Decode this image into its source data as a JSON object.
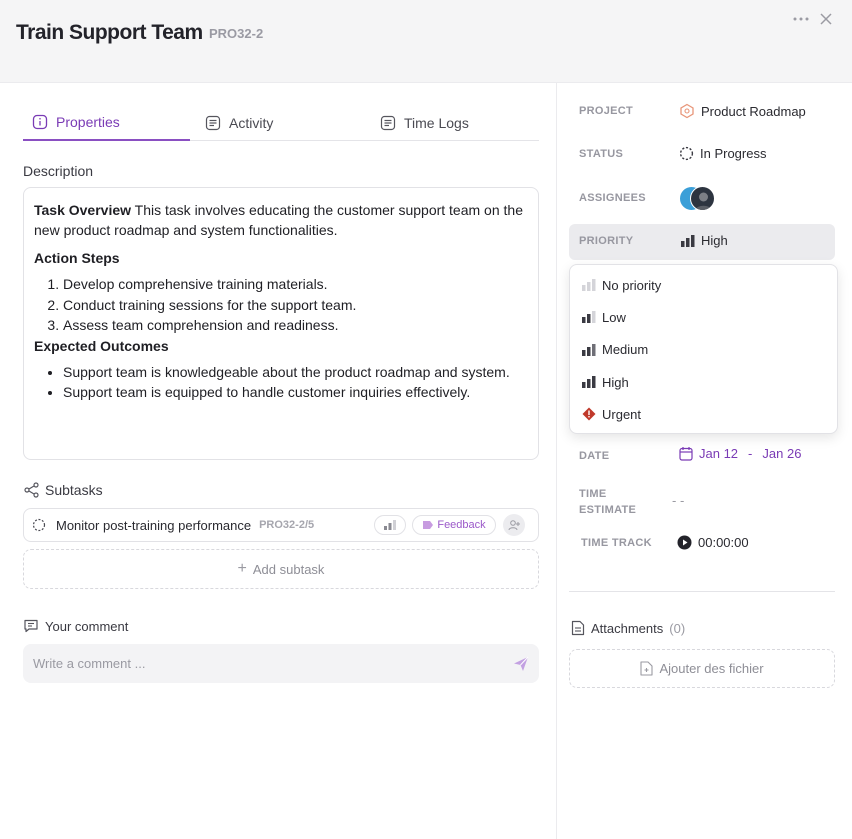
{
  "header": {
    "title": "Train Support Team",
    "code": "PRO32-2"
  },
  "tabs": [
    {
      "label": "Properties",
      "icon": "info-icon",
      "active": true
    },
    {
      "label": "Activity",
      "icon": "list-icon",
      "active": false
    },
    {
      "label": "Time Logs",
      "icon": "log-icon",
      "active": false
    }
  ],
  "description": {
    "label": "Description",
    "overview_title": "Task Overview",
    "overview_text": " This task involves educating the customer support team on the new product roadmap and system functionalities.",
    "action_title": "Action Steps",
    "action_steps": [
      "Develop comprehensive training materials.",
      "Conduct training sessions for the support team.",
      "Assess team comprehension and readiness."
    ],
    "outcomes_title": "Expected Outcomes",
    "outcomes": [
      "Support team is knowledgeable about the product roadmap and system.",
      "Support team is equipped to handle customer inquiries effectively."
    ]
  },
  "subtasks": {
    "label": "Subtasks",
    "items": [
      {
        "name": "Monitor post-training performance",
        "code": "PRO32-2/5",
        "tag": "Feedback"
      }
    ],
    "add_label": "Add subtask"
  },
  "comment": {
    "label": "Your comment",
    "placeholder": "Write a comment ..."
  },
  "properties": {
    "project_label": "PROJECT",
    "project_value": "Product Roadmap",
    "status_label": "STATUS",
    "status_value": "In Progress",
    "assignees_label": "ASSIGNEES",
    "priority_label": "PRIORITY",
    "priority_value": "High",
    "date_label": "DATE",
    "date_start": "Jan 12",
    "date_sep": "-",
    "date_end": "Jan 26",
    "estimate_label_1": "TIME",
    "estimate_label_2": "ESTIMATE",
    "estimate_value": "- -",
    "track_label": "TIME TRACK",
    "track_value": "00:00:00"
  },
  "priority_options": [
    {
      "label": "No priority",
      "level": 0
    },
    {
      "label": "Low",
      "level": 1
    },
    {
      "label": "Medium",
      "level": 2
    },
    {
      "label": "High",
      "level": 3
    },
    {
      "label": "Urgent",
      "level": 4
    }
  ],
  "attachments": {
    "label": "Attachments",
    "count": "(0)",
    "add_label": "Ajouter des fichier"
  },
  "colors": {
    "accent": "#7a3bb5",
    "urgent": "#c0392b",
    "tag": "#9b59c9"
  }
}
